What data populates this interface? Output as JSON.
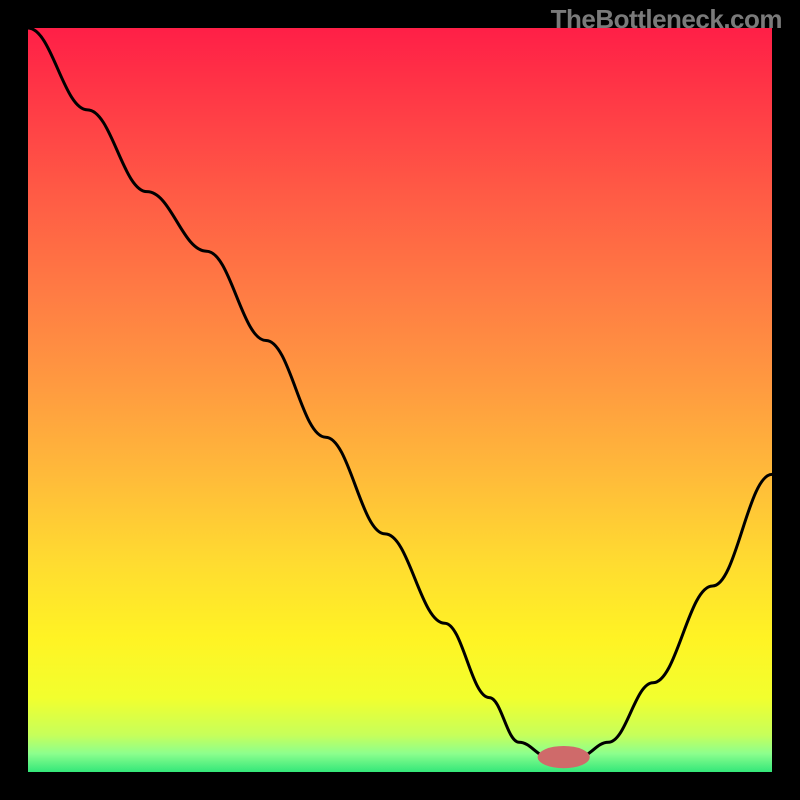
{
  "watermark": "TheBottleneck.com",
  "chart_data": {
    "type": "line",
    "title": "",
    "xlabel": "",
    "ylabel": "",
    "xlim": [
      0,
      100
    ],
    "ylim": [
      0,
      100
    ],
    "grid": false,
    "legend": false,
    "series": [
      {
        "name": "bottleneck-curve",
        "x": [
          0,
          8,
          16,
          24,
          32,
          40,
          48,
          56,
          62,
          66,
          70,
          74,
          78,
          84,
          92,
          100
        ],
        "y": [
          100,
          89,
          78,
          70,
          58,
          45,
          32,
          20,
          10,
          4,
          2,
          2,
          4,
          12,
          25,
          40
        ]
      }
    ],
    "marker": {
      "name": "optimal-point",
      "cx": 72,
      "cy": 2,
      "rx": 3.5,
      "ry": 1.5,
      "color": "#cf6a6a"
    },
    "gradient_stops": [
      {
        "offset": 0.0,
        "color": "#ff1f47"
      },
      {
        "offset": 0.1,
        "color": "#ff3a46"
      },
      {
        "offset": 0.22,
        "color": "#ff5a45"
      },
      {
        "offset": 0.35,
        "color": "#ff7a44"
      },
      {
        "offset": 0.48,
        "color": "#ff9a40"
      },
      {
        "offset": 0.6,
        "color": "#ffba3a"
      },
      {
        "offset": 0.72,
        "color": "#ffdc30"
      },
      {
        "offset": 0.82,
        "color": "#fff324"
      },
      {
        "offset": 0.9,
        "color": "#f2ff2e"
      },
      {
        "offset": 0.95,
        "color": "#c7ff5a"
      },
      {
        "offset": 0.975,
        "color": "#8dff8d"
      },
      {
        "offset": 1.0,
        "color": "#34e77a"
      }
    ]
  }
}
